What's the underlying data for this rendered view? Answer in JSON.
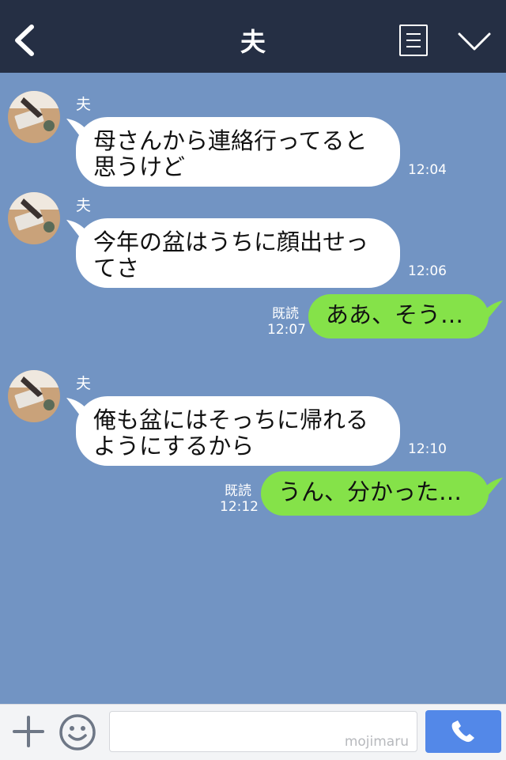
{
  "header": {
    "title": "夫"
  },
  "messages": [
    {
      "side": "left",
      "sender": "夫",
      "lines": [
        "母さんから連絡行ってると",
        "思うけど"
      ],
      "time": "12:04"
    },
    {
      "side": "left",
      "sender": "夫",
      "lines": [
        "今年の盆はうちに顔出せっ",
        "てさ"
      ],
      "time": "12:06"
    },
    {
      "side": "right",
      "read": "既読",
      "time": "12:07",
      "text": "ああ、そう…"
    },
    {
      "side": "left",
      "sender": "夫",
      "lines": [
        "俺も盆にはそっちに帰れる",
        "ようにするから"
      ],
      "time": "12:10"
    },
    {
      "side": "right",
      "read": "既読",
      "time": "12:12",
      "text": "うん、分かった…"
    }
  ],
  "footer": {
    "input_value": "",
    "watermark": "mojimaru"
  },
  "colors": {
    "header": "#252f44",
    "background": "#7294c3",
    "bubble_left": "#ffffff",
    "bubble_right": "#85e249",
    "call_button": "#5388e8"
  },
  "icons": [
    "back-icon",
    "menu-icon",
    "chevron-down-icon",
    "plus-icon",
    "emoji-icon",
    "phone-icon"
  ]
}
